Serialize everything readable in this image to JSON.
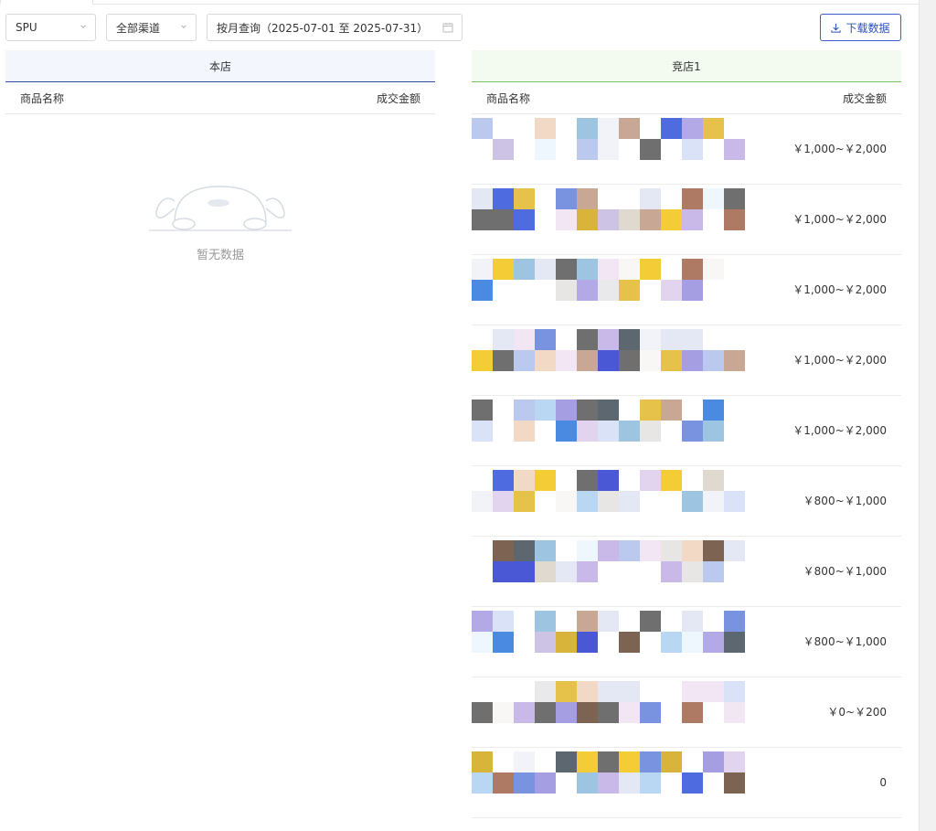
{
  "filters": {
    "dimension": "SPU",
    "channel": "全部渠道",
    "date_range": "按月查询（2025-07-01 至 2025-07-31）"
  },
  "toolbar": {
    "download_label": "下载数据"
  },
  "own_store": {
    "title": "本店",
    "columns": [
      "商品名称",
      "成交金额"
    ],
    "empty_text": "暂无数据"
  },
  "competitor": {
    "title": "竞店1",
    "columns": [
      "商品名称",
      "成交金额"
    ],
    "rows": [
      {
        "amount": "￥1,000~￥2,000"
      },
      {
        "amount": "￥1,000~￥2,000"
      },
      {
        "amount": "￥1,000~￥2,000"
      },
      {
        "amount": "￥1,000~￥2,000"
      },
      {
        "amount": "￥1,000~￥2,000"
      },
      {
        "amount": "￥800~￥1,000"
      },
      {
        "amount": "￥800~￥1,000"
      },
      {
        "amount": "￥800~￥1,000"
      },
      {
        "amount": "￥0~￥200"
      },
      {
        "amount": "0"
      }
    ]
  },
  "colors": {
    "accent": "#2d4fbf",
    "own_header_bg": "#f3f7fd",
    "competitor_header_bg": "#f3fbf0",
    "competitor_header_line": "#79c25f"
  },
  "icons": {
    "dropdown": "chevron-down-icon",
    "calendar": "calendar-icon",
    "download": "download-icon",
    "empty": "empty-state-dog-icon"
  }
}
